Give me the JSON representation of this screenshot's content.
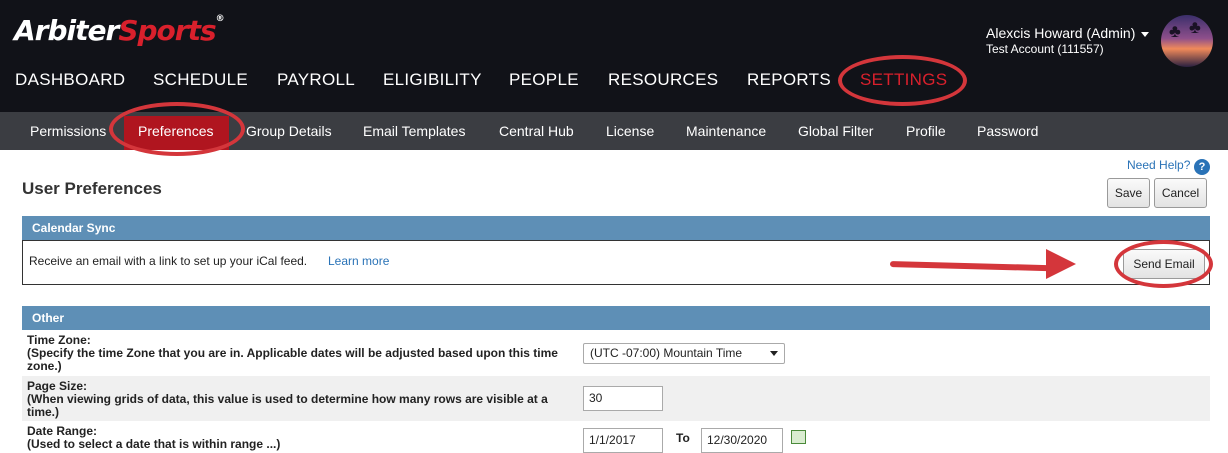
{
  "brand": {
    "logo_part1": "Arbiter",
    "logo_part2": "Sports",
    "trademark": "®"
  },
  "user": {
    "name": "Alexcis Howard (Admin)",
    "account": "Test Account (111557)"
  },
  "main_nav": [
    "DASHBOARD",
    "SCHEDULE",
    "PAYROLL",
    "ELIGIBILITY",
    "PEOPLE",
    "RESOURCES",
    "REPORTS",
    "SETTINGS"
  ],
  "main_nav_active": "SETTINGS",
  "sub_nav": [
    "Permissions",
    "Preferences",
    "Group Details",
    "Email Templates",
    "Central Hub",
    "License",
    "Maintenance",
    "Global Filter",
    "Profile",
    "Password"
  ],
  "sub_nav_active": "Preferences",
  "help": {
    "label": "Need Help?",
    "icon": "question-icon"
  },
  "page": {
    "title": "User Preferences",
    "save_label": "Save",
    "cancel_label": "Cancel"
  },
  "calendar_sync": {
    "header": "Calendar Sync",
    "text": "Receive an email with a link to set up your iCal feed.",
    "learn_more": "Learn more",
    "send_email_label": "Send Email"
  },
  "other": {
    "header": "Other",
    "time_zone": {
      "label": "Time Zone:",
      "help": "(Specify the time Zone that you are in. Applicable dates will be adjusted based upon this time zone.)",
      "value": "(UTC -07:00) Mountain Time"
    },
    "page_size": {
      "label": "Page Size:",
      "help": "(When viewing grids of data, this value is used to determine how many rows are visible at a time.)",
      "value": "30"
    },
    "date_range": {
      "label": "Date Range:",
      "help": "(Used to select a date that is within range ...)",
      "from": "1/1/2017",
      "to_label": "To",
      "to": "12/30/2020"
    }
  },
  "colors": {
    "accent_red": "#d9202c",
    "section_blue": "#5e8fb6",
    "nav_dark": "#111218",
    "subnav_gray": "#3b3d42",
    "annotation_red": "#d4363b"
  }
}
